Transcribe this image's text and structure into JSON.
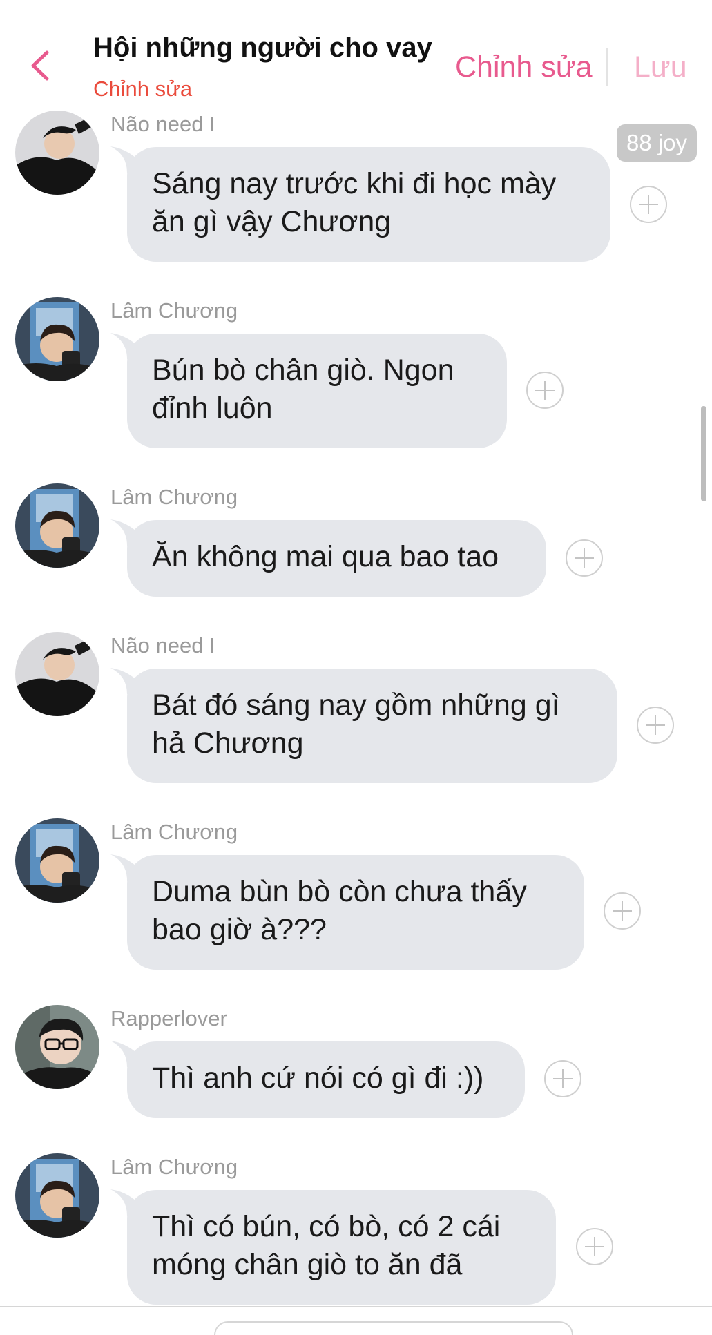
{
  "header": {
    "title": "Hội những người cho vay",
    "subtitle": "Chỉnh sửa",
    "edit_label": "Chỉnh sửa",
    "save_label": "Lưu"
  },
  "badge": {
    "label": "88 joy"
  },
  "colors": {
    "accent": "#e85a8e",
    "accent_light": "#f4afc8",
    "subtitle_red": "#ea4b3c",
    "bubble_bg": "#e5e7eb",
    "sender_gray": "#9a9a9a"
  },
  "messages": [
    {
      "sender": "Não need I",
      "avatar": "avatar-nao",
      "lines": [
        "Sáng nay trước khi đi học mày",
        "ăn gì vậy Chương"
      ]
    },
    {
      "sender": "Lâm Chương",
      "avatar": "avatar-lam",
      "lines": [
        "Bún bò chân giò. Ngon",
        "đỉnh luôn"
      ]
    },
    {
      "sender": "Lâm Chương",
      "avatar": "avatar-lam",
      "lines": [
        "Ăn không mai qua bao tao"
      ]
    },
    {
      "sender": "Não need I",
      "avatar": "avatar-nao",
      "lines": [
        "Bát đó sáng nay gồm những gì",
        "hả Chương"
      ]
    },
    {
      "sender": "Lâm Chương",
      "avatar": "avatar-lam",
      "lines": [
        "Duma bùn bò còn chưa thấy",
        "bao giờ à???"
      ]
    },
    {
      "sender": "Rapperlover",
      "avatar": "avatar-rapper",
      "lines": [
        "Thì anh cứ nói có gì đi :))"
      ]
    },
    {
      "sender": "Lâm Chương",
      "avatar": "avatar-lam",
      "lines": [
        "Thì có bún, có bò, có 2 cái",
        "móng chân giò to ăn đã"
      ]
    }
  ]
}
